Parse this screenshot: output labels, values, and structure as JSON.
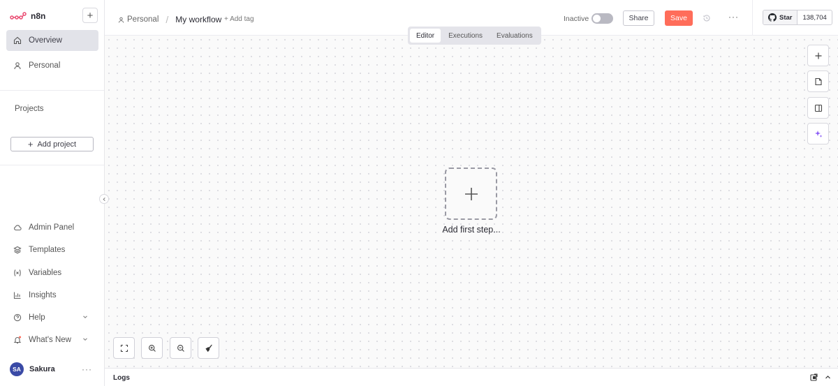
{
  "brand": {
    "name": "n8n"
  },
  "sidebar": {
    "new_label": "+",
    "top_items": [
      {
        "label": "Overview",
        "icon": "home-icon",
        "active": true
      },
      {
        "label": "Personal",
        "icon": "user-icon"
      }
    ],
    "projects_title": "Projects",
    "add_project_label": "Add project",
    "bottom_items": [
      {
        "label": "Admin Panel",
        "icon": "cloud-icon"
      },
      {
        "label": "Templates",
        "icon": "layers-icon"
      },
      {
        "label": "Variables",
        "icon": "variable-icon"
      },
      {
        "label": "Insights",
        "icon": "bar-chart-icon"
      },
      {
        "label": "Help",
        "icon": "help-circle-icon"
      },
      {
        "label": "What's New",
        "icon": "bell-icon"
      }
    ],
    "user": {
      "initials": "SA",
      "name": "Sakura",
      "menu": "···"
    }
  },
  "header": {
    "breadcrumb_home": "Personal",
    "breadcrumb_sep": "/",
    "workflow_title": "My workflow",
    "add_tag": "+ Add tag",
    "status_label": "Inactive",
    "share_label": "Share",
    "save_label": "Save",
    "more_label": "···",
    "github": {
      "star_label": "Star",
      "count": "138,704"
    }
  },
  "tabs": [
    {
      "label": "Editor",
      "active": true
    },
    {
      "label": "Executions"
    },
    {
      "label": "Evaluations"
    }
  ],
  "canvas": {
    "add_first_step": "Add first step..."
  },
  "logs": {
    "label": "Logs"
  },
  "colors": {
    "accent": "#ff6d5a",
    "avatar": "#3a4aa6",
    "sparkle": "#8b5cf6"
  }
}
